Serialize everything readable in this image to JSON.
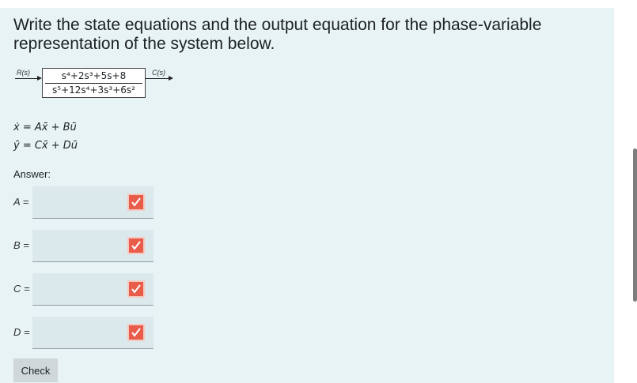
{
  "question": {
    "text": "Write the state equations and the output equation for the phase-variable representation of the system below."
  },
  "diagram": {
    "input_label": "R(s)",
    "output_label": "C(s)",
    "numerator": "s⁴+2s³+5s+8",
    "denominator": "s⁵+12s⁴+3s³+6s²"
  },
  "equations": {
    "state": "ẋ = Ax̄ + Bū",
    "output": "ȳ = Cx̄ + Dū"
  },
  "answer": {
    "label": "Answer:",
    "fields": [
      {
        "label": "A =",
        "value": ""
      },
      {
        "label": "B =",
        "value": ""
      },
      {
        "label": "C =",
        "value": ""
      },
      {
        "label": "D =",
        "value": ""
      }
    ]
  },
  "check_button": {
    "label": "Check"
  },
  "colors": {
    "card_bg": "#e7f3f5",
    "stamp": "#e85c4a",
    "field_bg": "#dce9ec"
  },
  "icons": {
    "stamp": "matrix-input-icon"
  }
}
